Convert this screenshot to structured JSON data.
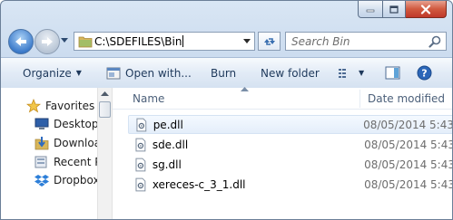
{
  "window": {
    "controls": {
      "minimize": "minimize",
      "maximize": "maximize",
      "close": "close"
    }
  },
  "address": {
    "path": "C:\\SDEFILES\\Bin",
    "search_placeholder": "Search Bin"
  },
  "toolbar": {
    "organize": "Organize",
    "open_with": "Open with...",
    "burn": "Burn",
    "new_folder": "New folder"
  },
  "nav": {
    "items": [
      {
        "label": "Favorites",
        "icon": "star-icon"
      },
      {
        "label": "Desktop",
        "icon": "desktop-icon"
      },
      {
        "label": "Downloa",
        "icon": "downloads-icon"
      },
      {
        "label": "Recent Pl",
        "icon": "recent-places-icon"
      },
      {
        "label": "Dropbox",
        "icon": "dropbox-icon"
      }
    ]
  },
  "files": {
    "columns": {
      "name": "Name",
      "date": "Date modified"
    },
    "rows": [
      {
        "name": "pe.dll",
        "date": "08/05/2014 5:43",
        "selected": true
      },
      {
        "name": "sde.dll",
        "date": "08/05/2014 5:43",
        "selected": false
      },
      {
        "name": "sg.dll",
        "date": "08/05/2014 5:43",
        "selected": false
      },
      {
        "name": "xereces-c_3_1.dll",
        "date": "08/05/2014 5:43",
        "selected": false
      }
    ]
  },
  "colors": {
    "accent": "#3e7ccb",
    "close": "#c0392b",
    "toolbar_text": "#1e395b"
  }
}
